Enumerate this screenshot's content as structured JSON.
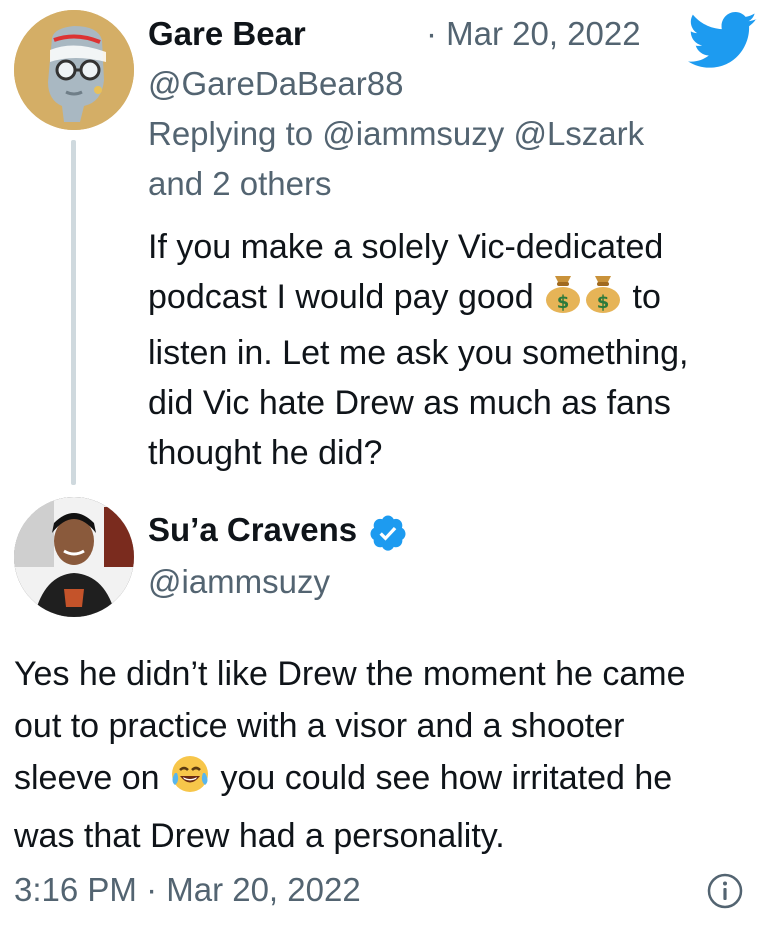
{
  "reply_tweet": {
    "author_name": "Gare Bear",
    "date": "· Mar 20, 2022",
    "handle": "@GareDaBear88",
    "replying_to_line1": "Replying to @iammsuzy @Lszark",
    "replying_to_line2": "and 2 others",
    "body_lines": [
      "If you make a solely Vic-dedicated",
      "podcast I would pay good",
      "to",
      "listen in. Let me ask you something,",
      "did Vic hate Drew as much as fans",
      "thought he did?"
    ],
    "inline_emoji": [
      "money-bag-emoji",
      "money-bag-emoji"
    ]
  },
  "main_tweet": {
    "author_name": "Su’a Cravens",
    "handle": "@iammsuzy",
    "verified": true,
    "body_lines": [
      "Yes he didn’t like Drew the moment he came",
      "out to practice with a visor and a shooter",
      "sleeve on",
      "you could see how irritated he",
      "was that Drew had a personality."
    ],
    "inline_emoji": "tears-of-joy-emoji",
    "timestamp": "3:16 PM · Mar 20, 2022"
  },
  "colors": {
    "twitter_blue": "#1d9bf0",
    "secondary_text": "#536471",
    "primary_text": "#0f1419",
    "thread_line": "#cfd9de"
  }
}
